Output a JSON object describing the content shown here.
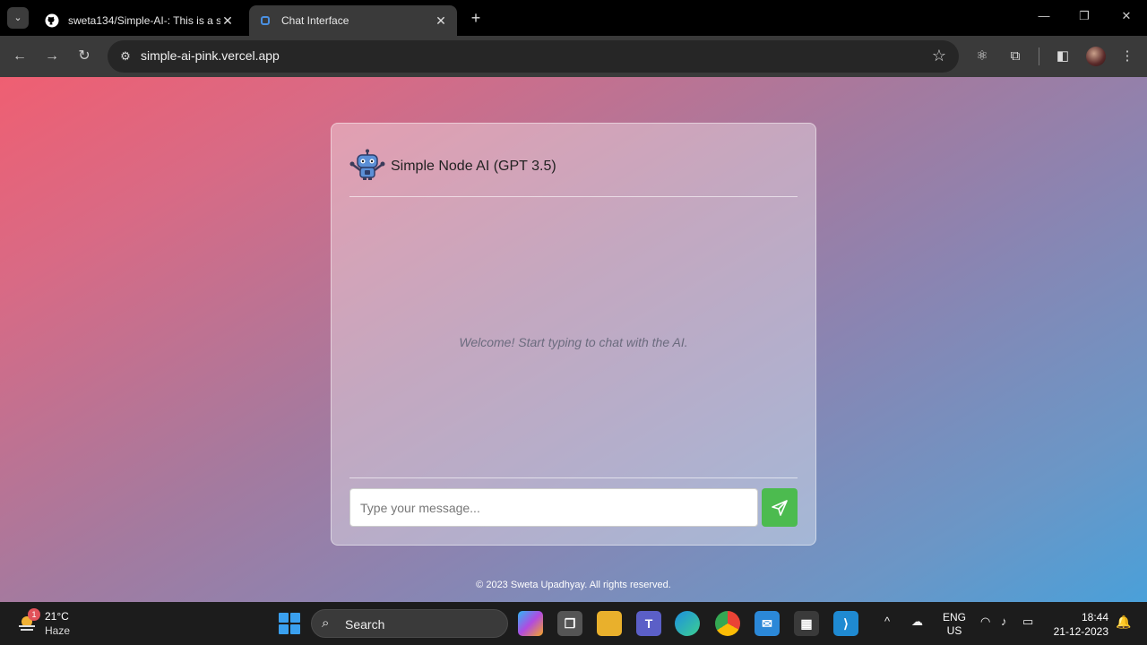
{
  "browser": {
    "tabs": [
      {
        "title": "sweta134/Simple-AI-: This is a s",
        "favicon": "github-icon"
      },
      {
        "title": "Chat Interface",
        "favicon": "page-icon",
        "active": true
      }
    ],
    "url": "simple-ai-pink.vercel.app"
  },
  "app": {
    "title": "Simple Node AI (GPT 3.5)",
    "welcome": "Welcome! Start typing to chat with the AI.",
    "input_placeholder": "Type your message...",
    "footer": "© 2023 Sweta Upadhyay. All rights reserved.",
    "accent_color": "#4cbb4f"
  },
  "taskbar": {
    "weather_temp": "21°C",
    "weather_condition": "Haze",
    "weather_badge": "1",
    "search_label": "Search",
    "lang_line1": "ENG",
    "lang_line2": "US",
    "time": "18:44",
    "date": "21-12-2023"
  }
}
